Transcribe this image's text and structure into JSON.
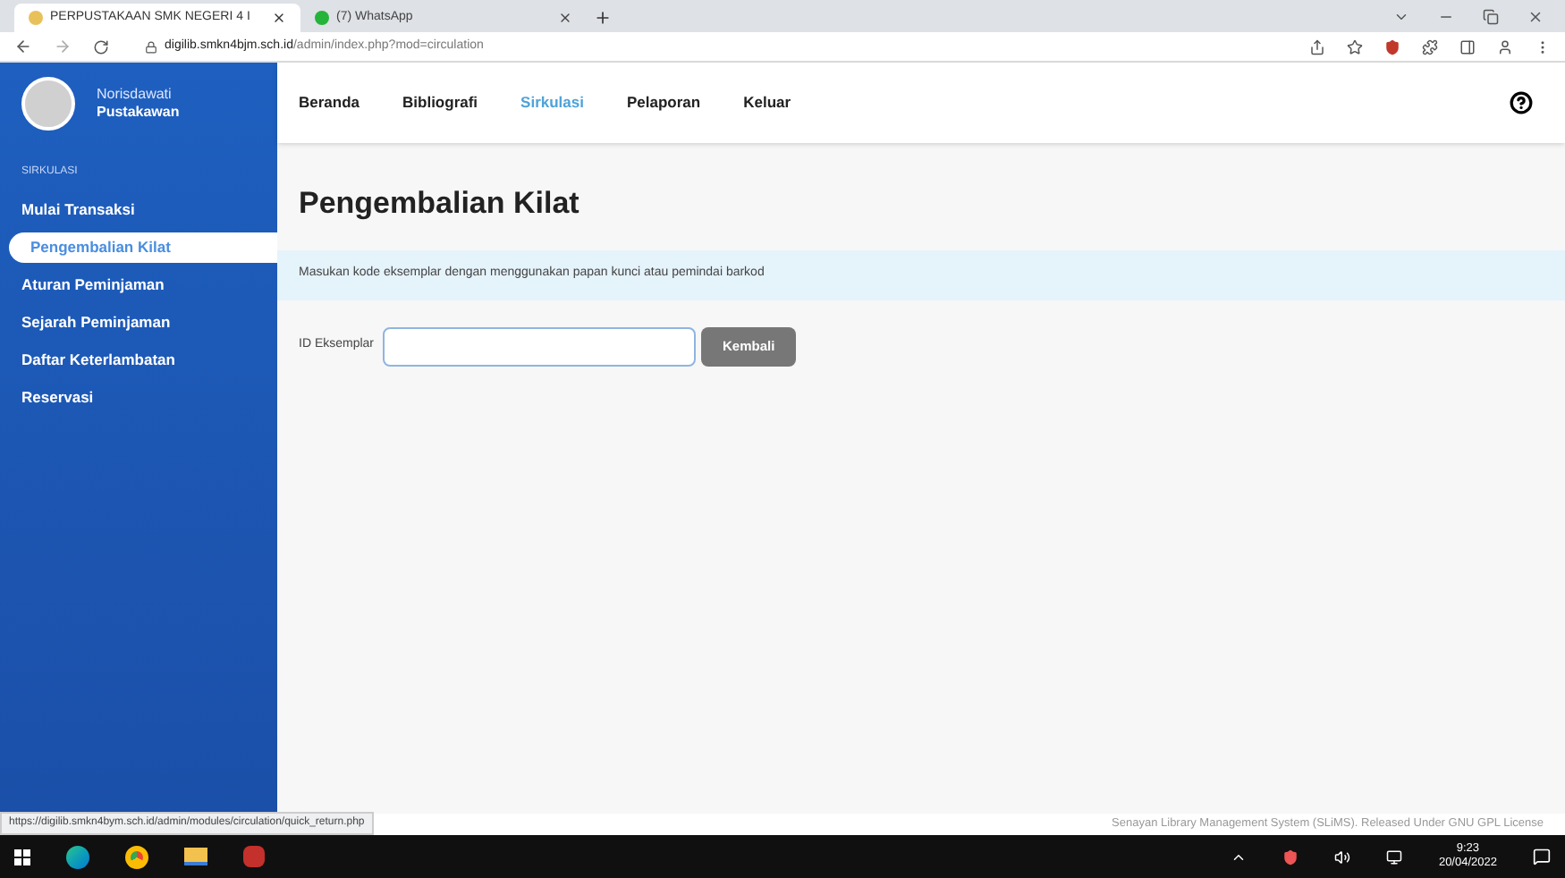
{
  "browser": {
    "tabs": [
      {
        "title": "PERPUSTAKAAN SMK NEGERI 4 I",
        "selected": true
      },
      {
        "title": "(7) WhatsApp",
        "selected": false
      }
    ],
    "address": {
      "host": "digilib.smkn4bjm.sch.id",
      "path": "/admin/index.php?mod=circulation"
    }
  },
  "user": {
    "name": "Norisdawati",
    "role": "Pustakawan"
  },
  "sidebar": {
    "heading": "SIRKULASI",
    "items": [
      {
        "label": "Mulai Transaksi",
        "selected": false
      },
      {
        "label": "Pengembalian Kilat",
        "selected": true
      },
      {
        "label": "Aturan Peminjaman",
        "selected": false
      },
      {
        "label": "Sejarah Peminjaman",
        "selected": false
      },
      {
        "label": "Daftar Keterlambatan",
        "selected": false
      },
      {
        "label": "Reservasi",
        "selected": false
      }
    ]
  },
  "nav": [
    {
      "label": "Beranda",
      "selected": false
    },
    {
      "label": "Bibliografi",
      "selected": false
    },
    {
      "label": "Sirkulasi",
      "selected": true
    },
    {
      "label": "Pelaporan",
      "selected": false
    },
    {
      "label": "Keluar",
      "selected": false
    }
  ],
  "page": {
    "title": "Pengembalian Kilat",
    "info": "Masukan kode eksemplar dengan menggunakan papan kunci atau pemindai barkod",
    "field_label": "ID Eksemplar",
    "button": "Kembali"
  },
  "footer": "Senayan Library Management System (SLiMS). Released Under GNU GPL License",
  "status_url": "https://digilib.smkn4bym.sch.id/admin/modules/circulation/quick_return.php",
  "taskbar": {
    "time": "9:23",
    "date": "20/04/2022"
  }
}
